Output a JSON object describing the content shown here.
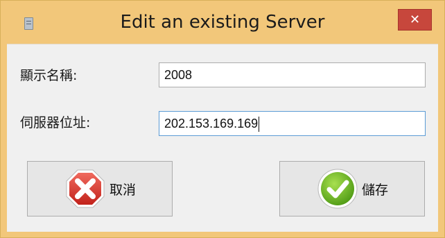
{
  "window": {
    "title": "Edit an existing Server",
    "close_glyph": "✕"
  },
  "form": {
    "display_name_label": "顯示名稱:",
    "display_name_value": "2008",
    "server_address_label": "伺服器位址:",
    "server_address_value": "202.153.169.169"
  },
  "buttons": {
    "cancel_label": "取消",
    "save_label": "儲存"
  },
  "colors": {
    "titlebar": "#f2c77a",
    "close": "#c7473c",
    "cancel_icon": "#d8403a",
    "save_icon": "#6cbf2a"
  }
}
